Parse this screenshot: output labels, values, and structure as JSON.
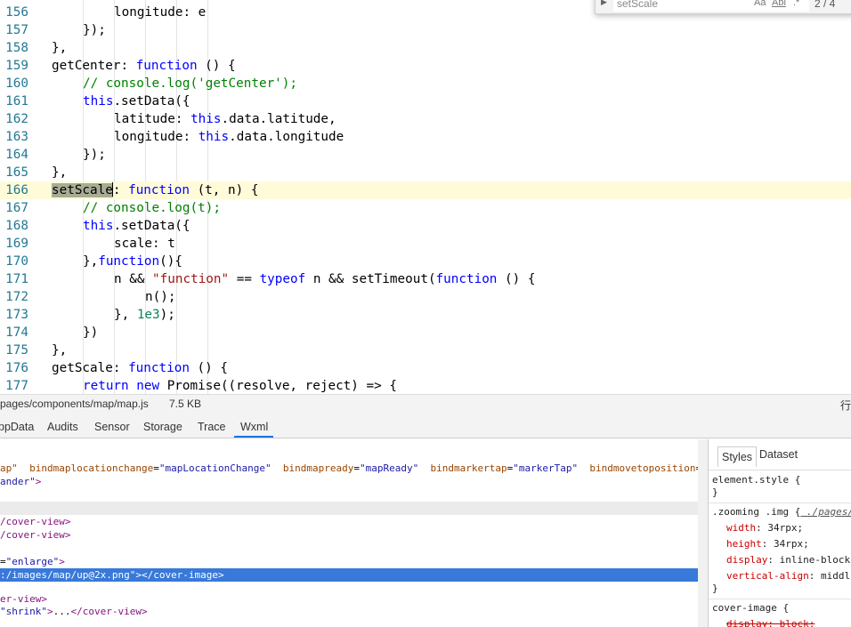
{
  "editor": {
    "lines": [
      {
        "n": "156",
        "indent": 4,
        "tokens": [
          [
            "pn",
            "longitude: e"
          ]
        ]
      },
      {
        "n": "157",
        "indent": 3,
        "tokens": [
          [
            "pn",
            "});"
          ]
        ]
      },
      {
        "n": "158",
        "indent": 2,
        "tokens": [
          [
            "pn",
            "},"
          ]
        ]
      },
      {
        "n": "159",
        "indent": 2,
        "tokens": [
          [
            "pn",
            "getCenter: "
          ],
          [
            "kw",
            "function"
          ],
          [
            "pn",
            " () {"
          ]
        ]
      },
      {
        "n": "160",
        "indent": 3,
        "tokens": [
          [
            "cm",
            "// console.log('getCenter');"
          ]
        ]
      },
      {
        "n": "161",
        "indent": 3,
        "tokens": [
          [
            "kw",
            "this"
          ],
          [
            "pn",
            ".setData({"
          ]
        ]
      },
      {
        "n": "162",
        "indent": 4,
        "tokens": [
          [
            "pn",
            "latitude: "
          ],
          [
            "kw",
            "this"
          ],
          [
            "pn",
            ".data.latitude,"
          ]
        ]
      },
      {
        "n": "163",
        "indent": 4,
        "tokens": [
          [
            "pn",
            "longitude: "
          ],
          [
            "kw",
            "this"
          ],
          [
            "pn",
            ".data.longitude"
          ]
        ]
      },
      {
        "n": "164",
        "indent": 3,
        "tokens": [
          [
            "pn",
            "});"
          ]
        ]
      },
      {
        "n": "165",
        "indent": 2,
        "tokens": [
          [
            "pn",
            "},"
          ]
        ]
      },
      {
        "n": "166",
        "indent": 2,
        "current": true,
        "tokens": [
          [
            "hl",
            "setScale"
          ],
          [
            "caret",
            ""
          ],
          [
            "pn",
            ": "
          ],
          [
            "kw",
            "function"
          ],
          [
            "pn",
            " (t, n) {"
          ]
        ]
      },
      {
        "n": "167",
        "indent": 3,
        "tokens": [
          [
            "cm",
            "// console.log(t);"
          ]
        ]
      },
      {
        "n": "168",
        "indent": 3,
        "tokens": [
          [
            "kw",
            "this"
          ],
          [
            "pn",
            ".setData({"
          ]
        ]
      },
      {
        "n": "169",
        "indent": 4,
        "tokens": [
          [
            "pn",
            "scale: t"
          ]
        ]
      },
      {
        "n": "170",
        "indent": 3,
        "tokens": [
          [
            "pn",
            "},"
          ],
          [
            "kw",
            "function"
          ],
          [
            "pn",
            "(){"
          ]
        ]
      },
      {
        "n": "171",
        "indent": 4,
        "tokens": [
          [
            "pn",
            "n && "
          ],
          [
            "st",
            "\"function\""
          ],
          [
            "pn",
            " == "
          ],
          [
            "kw",
            "typeof"
          ],
          [
            "pn",
            " n && setTimeout("
          ],
          [
            "kw",
            "function"
          ],
          [
            "pn",
            " () {"
          ]
        ]
      },
      {
        "n": "172",
        "indent": 5,
        "tokens": [
          [
            "pn",
            "n();"
          ]
        ]
      },
      {
        "n": "173",
        "indent": 4,
        "tokens": [
          [
            "pn",
            "}, "
          ],
          [
            "nm",
            "1e3"
          ],
          [
            "pn",
            ");"
          ]
        ]
      },
      {
        "n": "174",
        "indent": 3,
        "tokens": [
          [
            "pn",
            "})"
          ]
        ]
      },
      {
        "n": "175",
        "indent": 2,
        "tokens": [
          [
            "pn",
            "},"
          ]
        ]
      },
      {
        "n": "176",
        "indent": 2,
        "tokens": [
          [
            "pn",
            "getScale: "
          ],
          [
            "kw",
            "function"
          ],
          [
            "pn",
            " () {"
          ]
        ]
      },
      {
        "n": "177",
        "indent": 3,
        "tokens": [
          [
            "kw",
            "return"
          ],
          [
            "pn",
            " "
          ],
          [
            "kw",
            "new"
          ],
          [
            "pn",
            " Promise((resolve, reject) => {"
          ]
        ]
      }
    ]
  },
  "find_widget": {
    "toggle_icon": "chevron-right-icon",
    "query": "setScale",
    "match_case_label": "Aa",
    "whole_word_label": "Abl",
    "regex_label": ".*",
    "count": "2 / 4"
  },
  "status_bar": {
    "path": "pages/components/map/map.js",
    "size": "7.5 KB",
    "right_text": "行"
  },
  "devtools": {
    "tabs": [
      "ppData",
      "Audits",
      "Sensor",
      "Storage",
      "Trace",
      "Wxml"
    ],
    "active_tab": "Wxml",
    "accent_color": "#1a73e8"
  },
  "wxml_tree": {
    "lines": [
      {
        "kind": "attrs",
        "text": [
          [
            "an",
            "ap\""
          ],
          [
            "pn",
            "  "
          ],
          [
            "an",
            "bindmaplocationchange"
          ],
          [
            "pn",
            "="
          ],
          [
            "av",
            "\"mapLocationChange\""
          ],
          [
            "pn",
            "  "
          ],
          [
            "an",
            "bindmapready"
          ],
          [
            "pn",
            "="
          ],
          [
            "av",
            "\"mapReady\""
          ],
          [
            "pn",
            "  "
          ],
          [
            "an",
            "bindmarkertap"
          ],
          [
            "pn",
            "="
          ],
          [
            "av",
            "\"markerTap\""
          ],
          [
            "pn",
            "  "
          ],
          [
            "an",
            "bindmovetoposition"
          ],
          [
            "pn",
            "="
          ],
          [
            "av",
            "\"m"
          ]
        ]
      },
      {
        "kind": "plain",
        "text": [
          [
            "av",
            "ander\""
          ],
          [
            "tg",
            ">"
          ]
        ]
      },
      {
        "kind": "blank",
        "text": []
      },
      {
        "kind": "hover",
        "text": []
      },
      {
        "kind": "plain",
        "text": [
          [
            "tg",
            "/cover-view>"
          ]
        ]
      },
      {
        "kind": "plain",
        "text": [
          [
            "tg",
            "/cover-view>"
          ]
        ]
      },
      {
        "kind": "blank",
        "text": []
      },
      {
        "kind": "plain",
        "text": [
          [
            "pn",
            "="
          ],
          [
            "av",
            "\"enlarge\""
          ],
          [
            "tg",
            ">"
          ]
        ]
      },
      {
        "kind": "selected",
        "text": [
          [
            "av",
            ":/images/map/up@2x.png\""
          ],
          [
            "tg",
            "></cover-image>"
          ]
        ]
      },
      {
        "kind": "blank",
        "text": []
      },
      {
        "kind": "plain",
        "text": [
          [
            "tg",
            "er-view>"
          ]
        ]
      },
      {
        "kind": "plain",
        "text": [
          [
            "av",
            "\"shrink\""
          ],
          [
            "tg",
            ">"
          ],
          [
            "pn",
            "..."
          ],
          [
            "tg",
            "</cover-view>"
          ]
        ]
      }
    ]
  },
  "styles_panel": {
    "tabs": [
      "Styles",
      "Dataset"
    ],
    "active_tab": "Styles",
    "rules": [
      {
        "selector": "element.style {",
        "source": "",
        "decls": [],
        "close": "}"
      },
      {
        "selector": ".zooming .img {",
        "source": "./pages/",
        "decls": [
          {
            "prop": "width",
            "val": "34rpx;",
            "struck": false
          },
          {
            "prop": "height",
            "val": "34rpx;",
            "struck": false
          },
          {
            "prop": "display",
            "val": "inline-block",
            "struck": false
          },
          {
            "prop": "vertical-align",
            "val": "middl",
            "struck": false
          }
        ],
        "close": "}"
      },
      {
        "selector": "cover-image {",
        "source": "",
        "decls": [
          {
            "prop": "display",
            "val": "block;",
            "struck": true
          }
        ],
        "close": ""
      }
    ]
  }
}
